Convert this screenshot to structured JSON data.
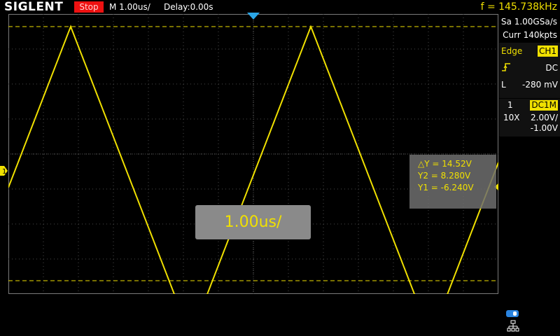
{
  "header": {
    "brand": "SIGLENT",
    "run_state": "Stop",
    "timebase": "M 1.00us/",
    "delay": "Delay:0.00s",
    "frequency": "f = 145.738kHz"
  },
  "acquisition": {
    "sample_rate": "Sa 1.00GSa/s",
    "memory": "Curr 140kpts"
  },
  "trigger": {
    "type": "Edge",
    "source": "CH1",
    "coupling": "DC",
    "level_label": "L",
    "level": "-280 mV",
    "slope_icon": "rising-edge-icon"
  },
  "channel": {
    "number": "1",
    "coupling_impedance": "DC1M",
    "probe": "10X",
    "scale": "2.00V/",
    "offset": "-1.00V"
  },
  "cursor_measurements": {
    "delta_y": "△Y = 14.52V",
    "y2": "Y2 = 8.280V",
    "y1": "Y1 = -6.240V"
  },
  "timebase_popup": "1.00us/",
  "channel_marker": "1",
  "colors": {
    "trace": "#f0e000",
    "stop": "#e11111",
    "trigger_position": "#2aa6e8",
    "background": "#000000"
  },
  "waveform": {
    "type": "triangle",
    "frequency_khz": 145.738,
    "y_max_v": 8.28,
    "y_min_v": -6.24,
    "time_per_div_us": 1.0,
    "volts_per_div": 2.0,
    "offset_v": -1.0
  },
  "status_icons": [
    "usb-icon",
    "network-icon"
  ]
}
